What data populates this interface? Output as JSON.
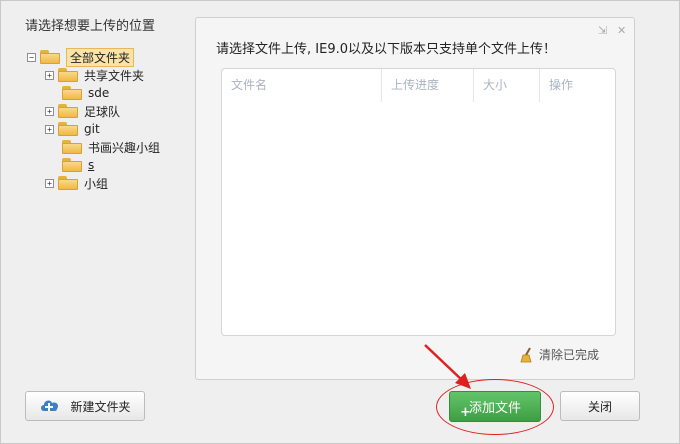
{
  "left_panel": {
    "title": "请选择想要上传的位置",
    "tree": [
      {
        "label": "全部文件夹",
        "expander": "−",
        "selected": true
      },
      {
        "label": "共享文件夹",
        "expander": "+"
      },
      {
        "label": "sde",
        "expander": ""
      },
      {
        "label": "足球队",
        "expander": "+"
      },
      {
        "label": "git",
        "expander": "+"
      },
      {
        "label": "书画兴趣小组",
        "expander": ""
      },
      {
        "label": "s",
        "expander": "",
        "underline": true
      },
      {
        "label": "小组",
        "expander": "+"
      }
    ]
  },
  "upload_panel": {
    "title": "请选择文件上传, IE9.0以及以下版本只支持单个文件上传！",
    "columns": [
      "文件名",
      "上传进度",
      "大小",
      "操作"
    ],
    "clear_label": "清除已完成",
    "restore_icon": "⇲",
    "close_icon": "✕"
  },
  "buttons": {
    "new_folder": "新建文件夹",
    "add_file": "添加文件",
    "add_plus": "+",
    "close": "关闭"
  },
  "colors": {
    "accent_green": "#4caf50",
    "annotation_red": "#e02020",
    "selected_bg": "#fbe3a8"
  }
}
